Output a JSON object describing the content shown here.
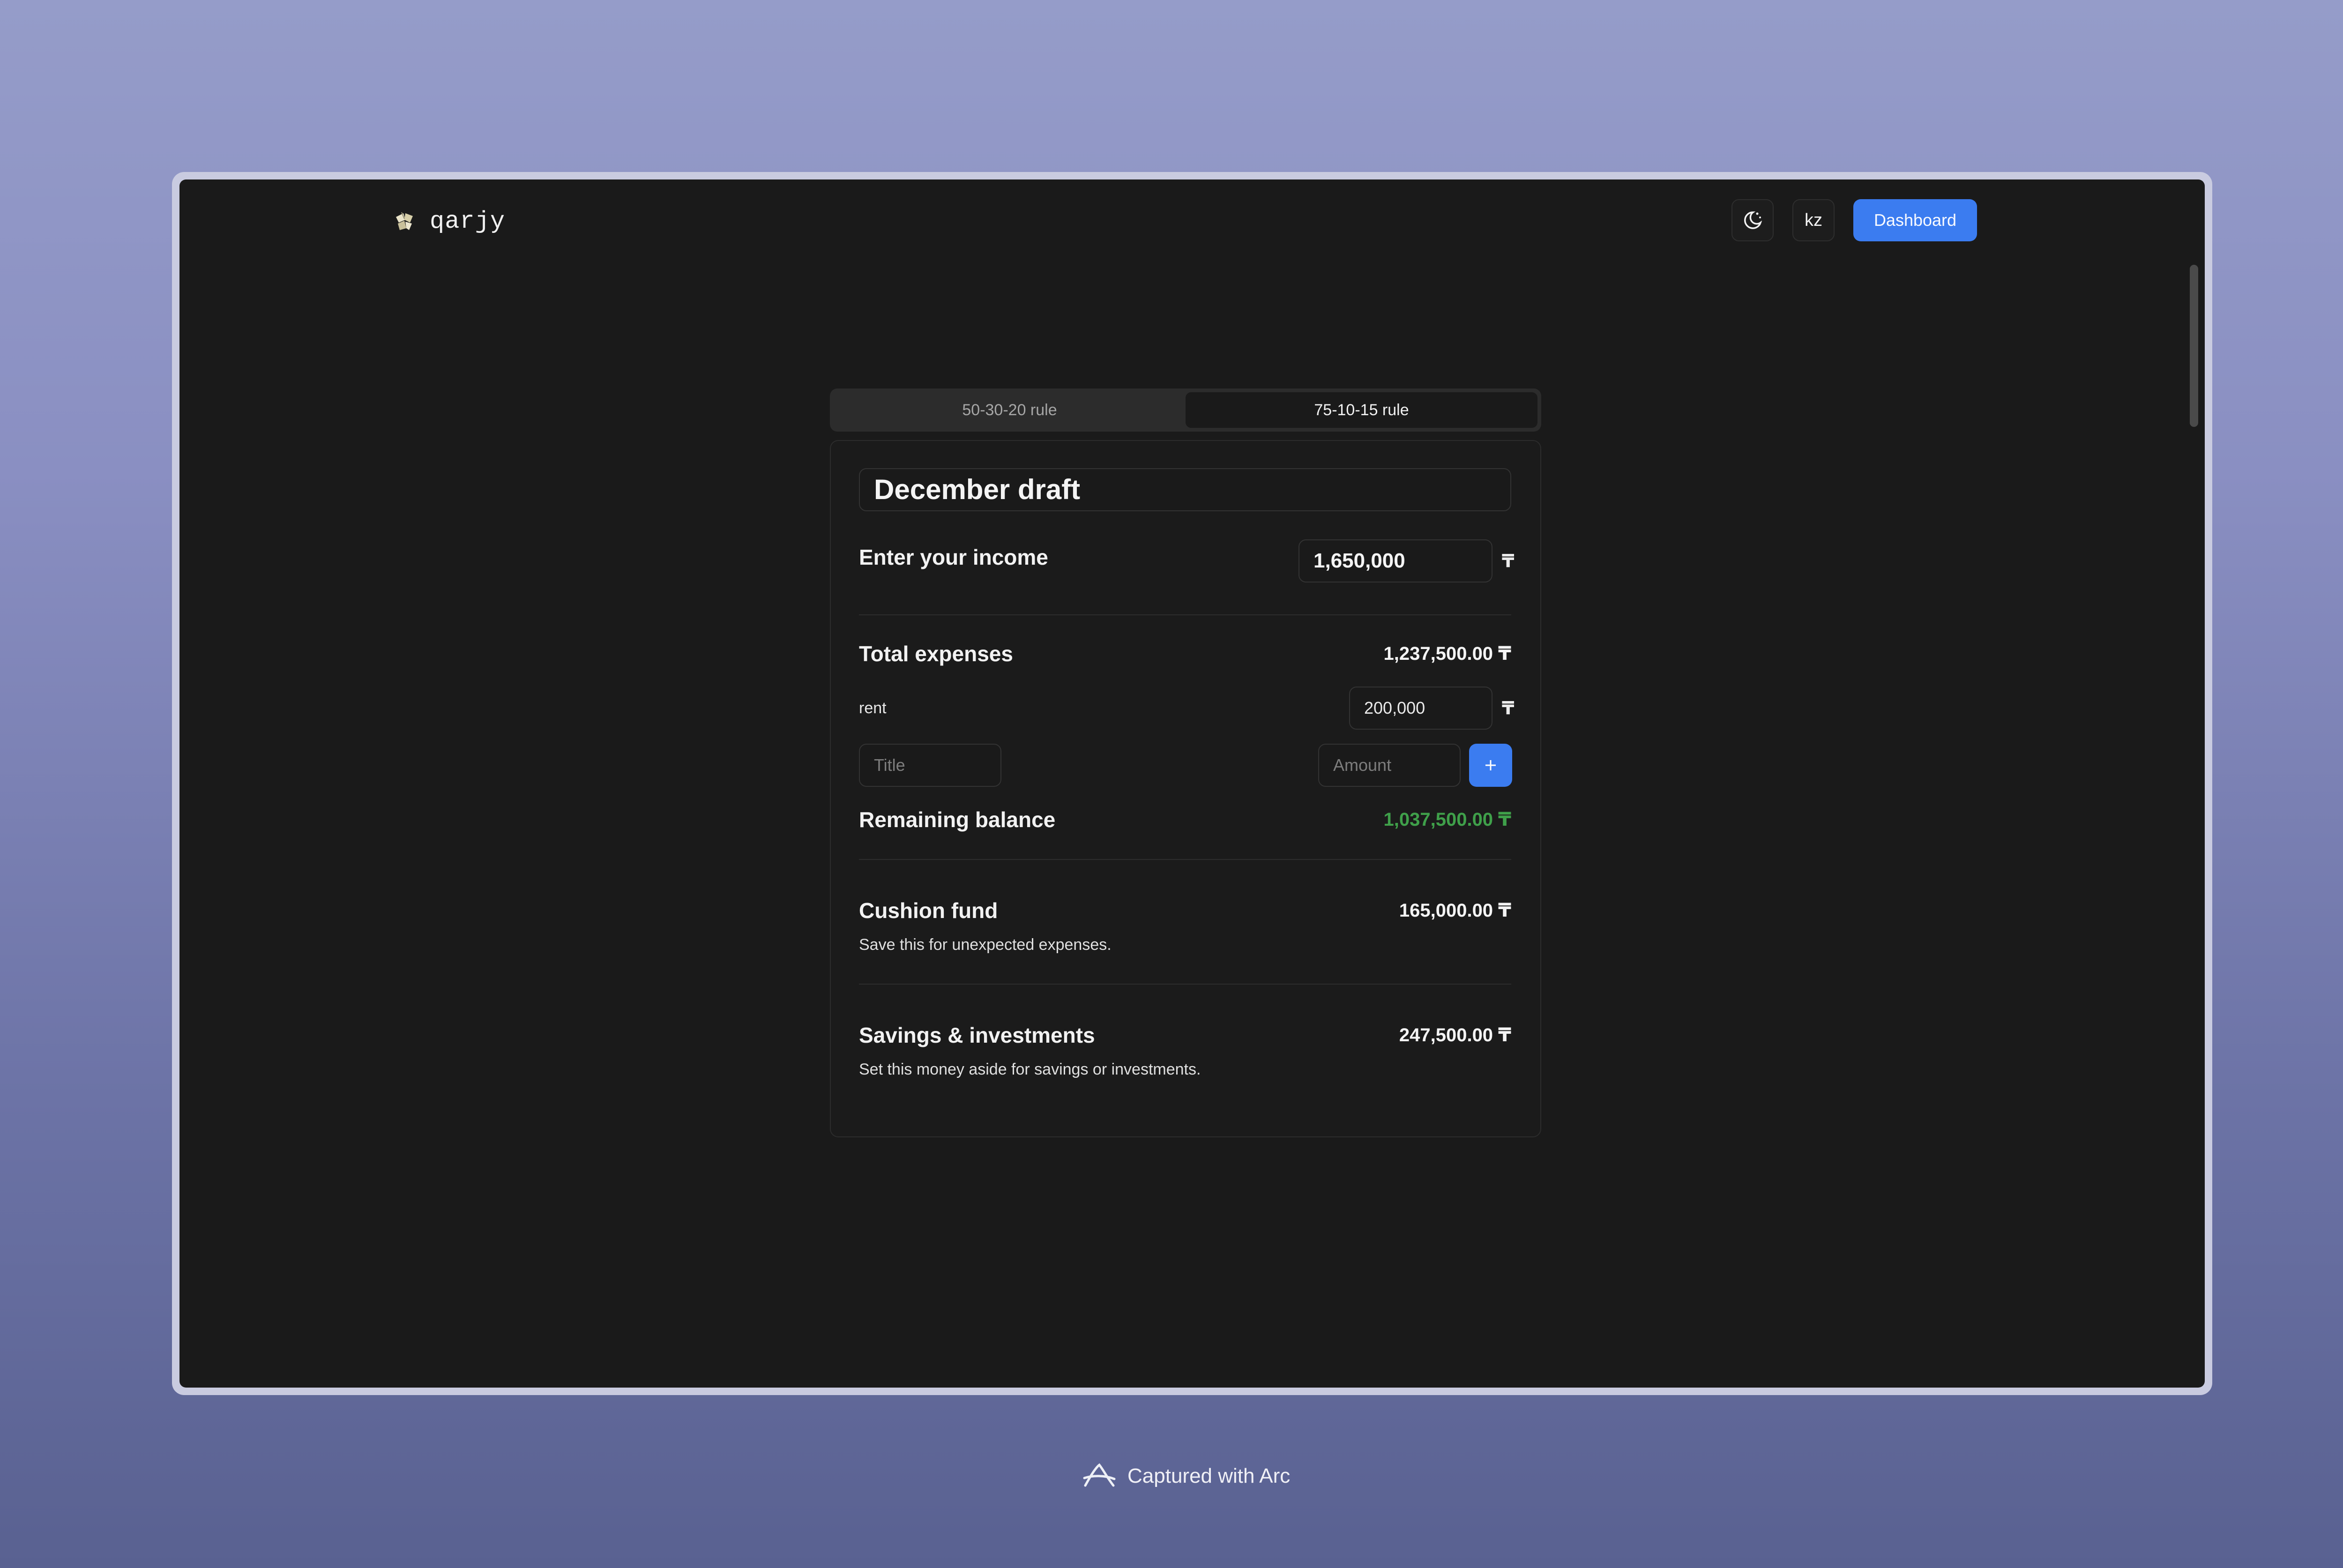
{
  "app": {
    "name": "qarjy",
    "logo_icon": "leaf-logo-icon"
  },
  "header": {
    "theme_toggle_icon": "moon-icon",
    "language_label": "kz",
    "dashboard_label": "Dashboard"
  },
  "rules": {
    "tabs": [
      {
        "label": "50-30-20 rule",
        "active": false
      },
      {
        "label": "75-10-15 rule",
        "active": true
      }
    ]
  },
  "budget": {
    "title": "December draft",
    "income_label": "Enter your income",
    "income_value": "1,650,000",
    "currency_symbol": "₸",
    "total_expenses_label": "Total expenses",
    "total_expenses_value": "1,237,500.00 ₸",
    "expenses": [
      {
        "title": "rent",
        "amount": "200,000"
      }
    ],
    "new_expense": {
      "title_placeholder": "Title",
      "amount_placeholder": "Amount",
      "add_icon": "plus-icon"
    },
    "remaining_label": "Remaining balance",
    "remaining_value": "1,037,500.00 ₸",
    "cushion_label": "Cushion fund",
    "cushion_value": "165,000.00 ₸",
    "cushion_desc": "Save this for unexpected expenses.",
    "savings_label": "Savings & investments",
    "savings_value": "247,500.00 ₸",
    "savings_desc": "Set this money aside for savings or investments."
  },
  "footer": {
    "text": "Captured with Arc"
  },
  "colors": {
    "accent": "#3b7cf0",
    "positive": "#3fa04a",
    "background": "#1a1a1a"
  }
}
